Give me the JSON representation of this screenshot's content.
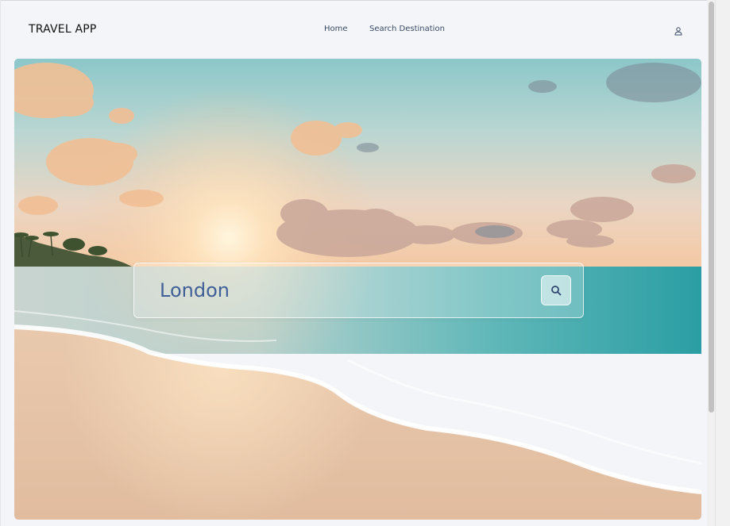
{
  "app": {
    "brand": "TRAVEL APP"
  },
  "nav": {
    "home_label": "Home",
    "search_label": "Search Destination"
  },
  "user": {
    "icon": "user-icon"
  },
  "hero": {
    "image": "beach-sunset-photo",
    "search": {
      "value": "London",
      "button_icon": "search-icon"
    }
  },
  "colors": {
    "page_bg": "#f3f5f8",
    "nav_link": "#3a4a66",
    "search_text": "#3f5f97"
  }
}
